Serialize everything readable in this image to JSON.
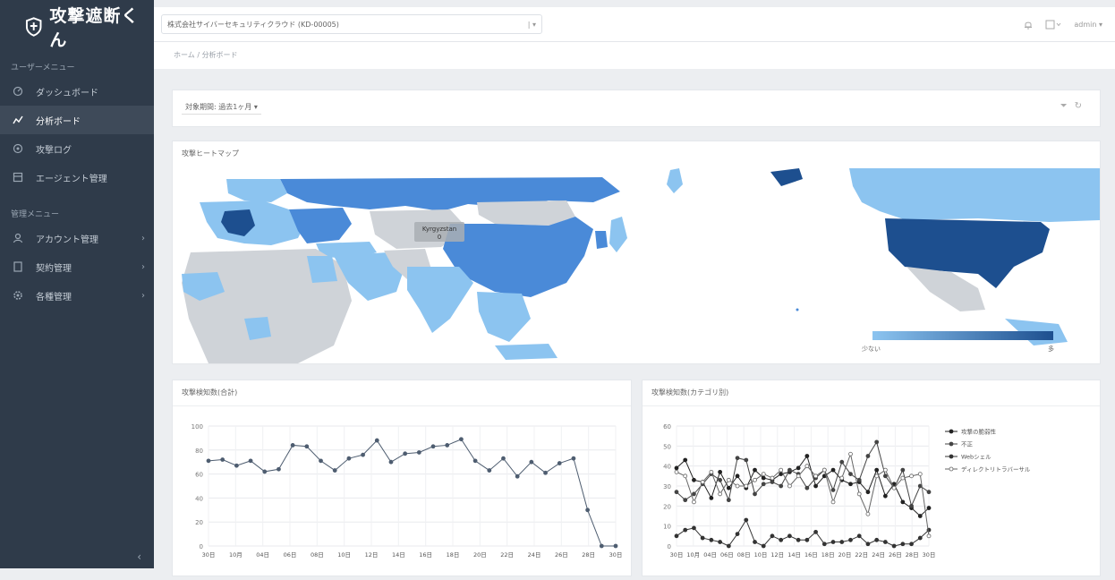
{
  "app": {
    "brand": "攻撃遮断くん"
  },
  "sidebar": {
    "user_menu_title": "ユーザーメニュー",
    "user_items": [
      {
        "label": "ダッシュボード",
        "icon": "dashboard-icon"
      },
      {
        "label": "分析ボード",
        "icon": "analysis-icon"
      },
      {
        "label": "攻撃ログ",
        "icon": "log-icon"
      },
      {
        "label": "エージェント管理",
        "icon": "agent-icon"
      }
    ],
    "admin_menu_title": "管理メニュー",
    "admin_items": [
      {
        "label": "アカウント管理",
        "icon": "account-icon"
      },
      {
        "label": "契約管理",
        "icon": "contract-icon"
      },
      {
        "label": "各種管理",
        "icon": "settings-icon"
      }
    ],
    "collapse_label": "‹"
  },
  "topbar": {
    "tenant": "株式会社サイバーセキュリティクラウド (KD-00005)",
    "user": "admin"
  },
  "breadcrumb": {
    "home": "ホーム",
    "current": "分析ボード"
  },
  "filter": {
    "period_label": "対象期間: 過去1ヶ月"
  },
  "map": {
    "title": "攻撃ヒートマップ",
    "tooltip": "Kyrgyzstan",
    "tooltip_value": "0",
    "legend_min": "少ない",
    "legend_max": "多",
    "colors": {
      "low": "#8cc4f0",
      "mid": "#4a8ad8",
      "high": "#1d4f8f",
      "none": "#cfd3d8"
    }
  },
  "chart1": {
    "title": "攻撃検知数(合計)"
  },
  "chart2": {
    "title": "攻撃検知数(カテゴリ別)"
  },
  "chart_data": [
    {
      "type": "line",
      "title": "攻撃検知数(合計)",
      "x": [
        "30日",
        "10月",
        "04日",
        "06日",
        "08日",
        "10日",
        "12日",
        "14日",
        "16日",
        "18日",
        "20日",
        "22日",
        "24日",
        "26日",
        "28日",
        "30日"
      ],
      "ylim": [
        0,
        100
      ],
      "yticks": [
        0,
        20,
        40,
        60,
        80,
        100
      ],
      "series": [
        {
          "values": [
            71,
            72,
            67,
            71,
            62,
            64,
            84,
            83,
            71,
            63,
            73,
            76,
            88,
            70,
            77,
            78,
            83,
            84,
            89,
            71,
            63,
            73,
            58,
            70,
            61,
            69,
            73,
            30,
            0,
            0
          ]
        }
      ],
      "grid": true
    },
    {
      "type": "line",
      "title": "攻撃検知数(カテゴリ別)",
      "x": [
        "30日",
        "10月",
        "04日",
        "06日",
        "08日",
        "10日",
        "12日",
        "14日",
        "16日",
        "18日",
        "20日",
        "22日",
        "24日",
        "26日",
        "28日",
        "30日"
      ],
      "ylim": [
        0,
        60
      ],
      "yticks": [
        0,
        10,
        20,
        30,
        40,
        50,
        60
      ],
      "legend_position": "right",
      "series": [
        {
          "name": "攻撃の脆弱性",
          "marker": "filled-circle",
          "values": [
            39,
            43,
            33,
            32,
            24,
            37,
            29,
            35,
            29,
            38,
            34,
            33,
            36,
            37,
            39,
            45,
            30,
            35,
            38,
            33,
            31,
            32,
            27,
            38,
            25,
            31,
            22,
            19,
            15,
            19
          ]
        },
        {
          "name": "不正",
          "marker": "filled-diamond",
          "values": [
            27,
            23,
            26,
            31,
            36,
            33,
            23,
            44,
            43,
            26,
            31,
            32,
            30,
            38,
            36,
            29,
            34,
            38,
            28,
            42,
            36,
            33,
            45,
            52,
            35,
            29,
            38,
            20,
            30,
            27
          ]
        },
        {
          "name": "Webシェル",
          "marker": "filled-circle",
          "values": [
            5,
            8,
            9,
            4,
            3,
            2,
            0,
            6,
            13,
            2,
            0,
            5,
            3,
            5,
            3,
            3,
            7,
            1,
            2,
            2,
            3,
            5,
            1,
            3,
            2,
            0,
            1,
            1,
            4,
            8
          ]
        },
        {
          "name": "ディレクトリトラバーサル",
          "marker": "open-circle",
          "values": [
            37,
            35,
            22,
            32,
            37,
            26,
            33,
            30,
            30,
            33,
            36,
            34,
            38,
            30,
            35,
            40,
            35,
            38,
            22,
            34,
            46,
            26,
            16,
            35,
            38,
            29,
            34,
            35,
            36,
            5
          ]
        }
      ]
    }
  ]
}
